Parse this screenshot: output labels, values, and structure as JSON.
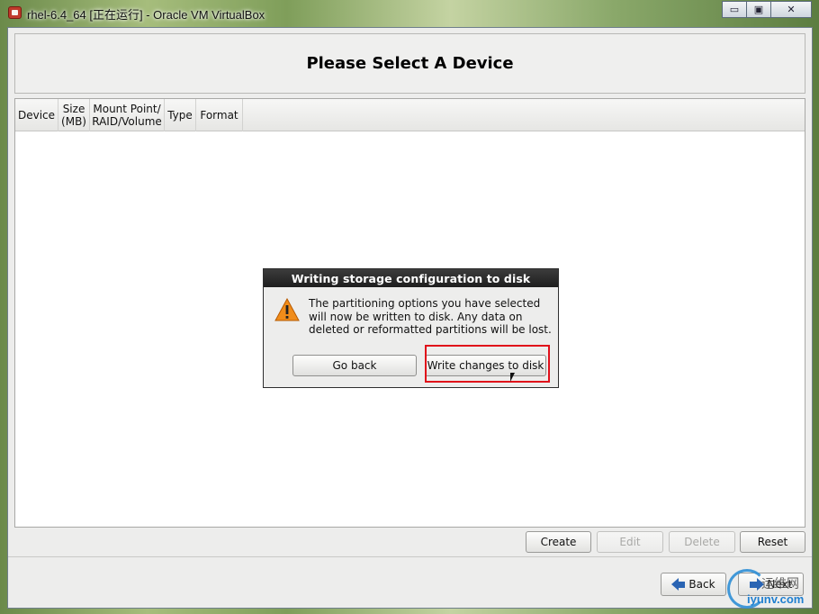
{
  "window": {
    "title": "rhel-6.4_64 [正在运行] - Oracle VM VirtualBox",
    "minimize_glyph": "▭",
    "maximize_glyph": "▣",
    "close_glyph": "✕"
  },
  "header": {
    "title": "Please Select A Device"
  },
  "table": {
    "columns": [
      "Device",
      "Size (MB)",
      "Mount Point/ RAID/Volume",
      "Type",
      "Format"
    ]
  },
  "actions": {
    "create": "Create",
    "edit": "Edit",
    "delete": "Delete",
    "reset": "Reset"
  },
  "nav": {
    "back": "Back",
    "next": "Next"
  },
  "dialog": {
    "title": "Writing storage configuration to disk",
    "message": "The partitioning options you have selected will now be written to disk.  Any data on deleted or reformatted partitions will be lost.",
    "go_back": "Go back",
    "write_changes": "Write changes to disk",
    "icon": "warning-icon"
  },
  "watermark": {
    "cn": "运维网",
    "en": "iyunv.com"
  },
  "colors": {
    "highlight": "#e0101a",
    "dialog_title_bg": "#2a2a2a",
    "arrow_blue": "#2a64b3"
  }
}
